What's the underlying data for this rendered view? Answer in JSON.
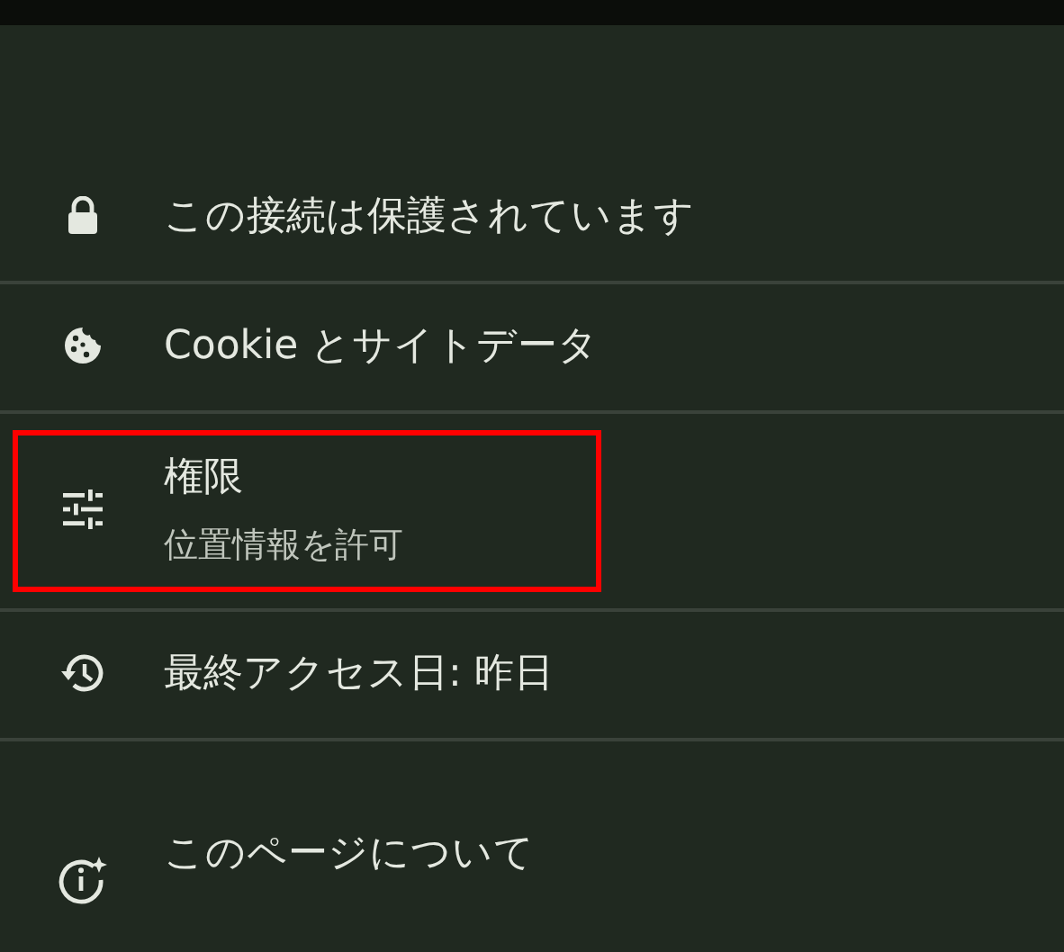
{
  "items": [
    {
      "kind": "lock",
      "title": "この接続は保護されています",
      "highlighted": false
    },
    {
      "kind": "cookie",
      "title": "Cookie とサイトデータ",
      "highlighted": false
    },
    {
      "kind": "tune",
      "title": "権限",
      "subtitle": "位置情報を許可",
      "highlighted": true
    },
    {
      "kind": "history",
      "title": "最終アクセス日: 昨日",
      "highlighted": false
    },
    {
      "kind": "info",
      "title": "このページについて",
      "highlighted": false
    }
  ]
}
